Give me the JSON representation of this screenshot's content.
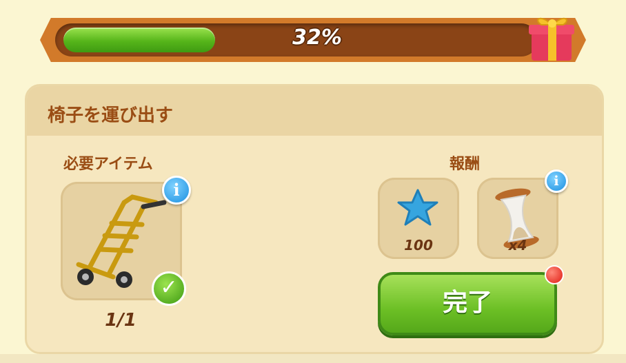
{
  "progress": {
    "percent_text": "32%",
    "fraction": 0.32
  },
  "quest": {
    "title": "椅子を運び出す"
  },
  "required": {
    "label": "必要アイテム",
    "item_icon": "hand-truck",
    "count": "1/1",
    "complete": true,
    "info_icon": "i"
  },
  "rewards": {
    "label": "報酬",
    "items": [
      {
        "icon": "blue-star",
        "amount": "100"
      },
      {
        "icon": "hourglass",
        "amount": "x4",
        "info_icon": "i"
      }
    ]
  },
  "action": {
    "complete_label": "完了"
  },
  "colors": {
    "accent_green": "#6cbf25",
    "brown_text": "#9a4d14",
    "progress_green": "#56b51a"
  }
}
